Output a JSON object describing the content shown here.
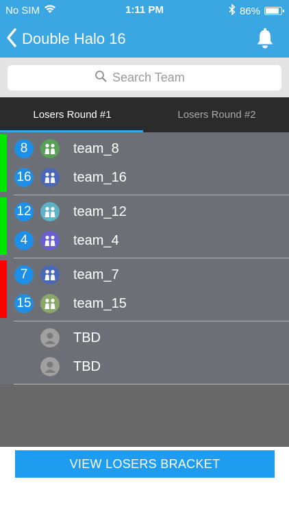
{
  "status_bar": {
    "carrier": "No SIM",
    "time": "1:11 PM",
    "battery_text": "86%",
    "battery_level": 0.86
  },
  "nav": {
    "title": "Double Halo 16",
    "back_icon": "chevron-left-icon",
    "bell_icon": "bell-icon"
  },
  "search": {
    "placeholder": "Search Team",
    "value": ""
  },
  "tabs": [
    {
      "label": "Losers Round #1",
      "active": true
    },
    {
      "label": "Losers Round #2",
      "active": false
    }
  ],
  "matches": [
    {
      "teams": [
        {
          "seed": "8",
          "name": "team_8",
          "status_color": "#00e600",
          "avatar_color": "#5aa05a"
        },
        {
          "seed": "16",
          "name": "team_16",
          "status_color": "#00e600",
          "avatar_color": "#4b67b8"
        }
      ]
    },
    {
      "teams": [
        {
          "seed": "12",
          "name": "team_12",
          "status_color": "#00e600",
          "avatar_color": "#5fb3c6"
        },
        {
          "seed": "4",
          "name": "team_4",
          "status_color": "#00e600",
          "avatar_color": "#6a5fd0"
        }
      ]
    },
    {
      "teams": [
        {
          "seed": "7",
          "name": "team_7",
          "status_color": "#ff0000",
          "avatar_color": "#4b67b8"
        },
        {
          "seed": "15",
          "name": "team_15",
          "status_color": "#ff0000",
          "avatar_color": "#8aa76a"
        }
      ]
    },
    {
      "teams": [
        {
          "seed": "",
          "name": "TBD",
          "status_color": "",
          "avatar_color": "#a0a0a0",
          "placeholder": true
        },
        {
          "seed": "",
          "name": "TBD",
          "status_color": "",
          "avatar_color": "#a0a0a0",
          "placeholder": true
        }
      ]
    }
  ],
  "bottom_button": {
    "label": "VIEW LOSERS BRACKET"
  },
  "colors": {
    "primary": "#3aa6e2",
    "button": "#1e9cf0",
    "seed_badge": "#1e8fe6",
    "list_background": "#6d6f76"
  }
}
